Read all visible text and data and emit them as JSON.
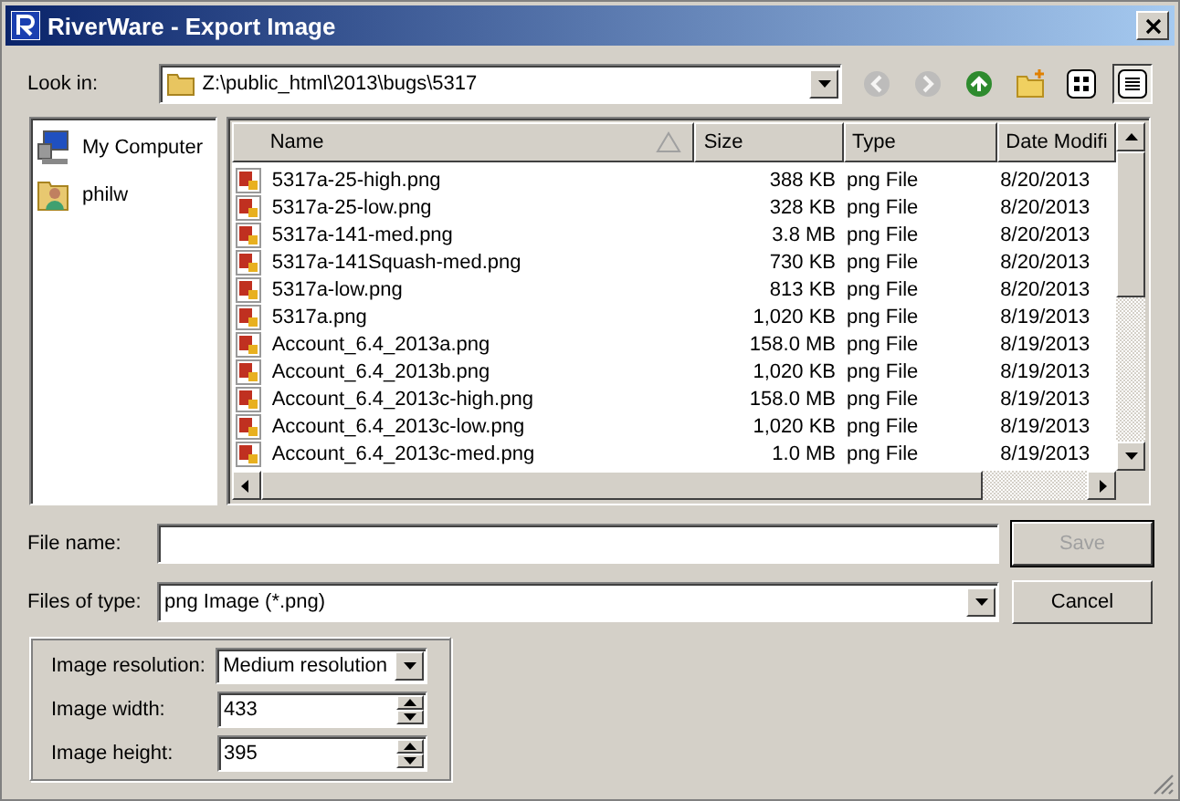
{
  "window": {
    "title": "RiverWare - Export Image"
  },
  "look_in": {
    "label": "Look in:",
    "value": "Z:\\public_html\\2013\\bugs\\5317"
  },
  "toolbar": [
    {
      "kind": "back",
      "disabled": true,
      "selected": false
    },
    {
      "kind": "forward",
      "disabled": true,
      "selected": false
    },
    {
      "kind": "up",
      "disabled": false,
      "selected": false
    },
    {
      "kind": "new-folder",
      "disabled": false,
      "selected": false
    },
    {
      "kind": "list-view",
      "disabled": false,
      "selected": false
    },
    {
      "kind": "details-view",
      "disabled": false,
      "selected": true
    }
  ],
  "places": [
    {
      "kind": "computer",
      "label": "My Computer"
    },
    {
      "kind": "user",
      "label": "philw"
    }
  ],
  "files": {
    "columns": [
      {
        "label": "Name",
        "sorted": true
      },
      {
        "label": "Size",
        "sorted": false
      },
      {
        "label": "Type",
        "sorted": false
      },
      {
        "label": "Date Modifi",
        "sorted": false
      }
    ],
    "rows": [
      {
        "name": "5317a-25-high.png",
        "size": "388 KB",
        "type": "png File",
        "date": "8/20/2013"
      },
      {
        "name": "5317a-25-low.png",
        "size": "328 KB",
        "type": "png File",
        "date": "8/20/2013"
      },
      {
        "name": "5317a-141-med.png",
        "size": "3.8 MB",
        "type": "png File",
        "date": "8/20/2013"
      },
      {
        "name": "5317a-141Squash-med.png",
        "size": "730 KB",
        "type": "png File",
        "date": "8/20/2013"
      },
      {
        "name": "5317a-low.png",
        "size": "813 KB",
        "type": "png File",
        "date": "8/20/2013"
      },
      {
        "name": "5317a.png",
        "size": "1,020 KB",
        "type": "png File",
        "date": "8/19/2013"
      },
      {
        "name": "Account_6.4_2013a.png",
        "size": "158.0 MB",
        "type": "png File",
        "date": "8/19/2013"
      },
      {
        "name": "Account_6.4_2013b.png",
        "size": "1,020 KB",
        "type": "png File",
        "date": "8/19/2013"
      },
      {
        "name": "Account_6.4_2013c-high.png",
        "size": "158.0 MB",
        "type": "png File",
        "date": "8/19/2013"
      },
      {
        "name": "Account_6.4_2013c-low.png",
        "size": "1,020 KB",
        "type": "png File",
        "date": "8/19/2013"
      },
      {
        "name": "Account_6.4_2013c-med.png",
        "size": "1.0 MB",
        "type": "png File",
        "date": "8/19/2013"
      }
    ]
  },
  "file_name": {
    "label": "File name:"
  },
  "file_type": {
    "label": "Files of type:",
    "value": "png Image (*.png)"
  },
  "buttons": [
    {
      "label": "Save",
      "disabled": true
    },
    {
      "label": "Cancel",
      "disabled": false
    }
  ],
  "options": [
    {
      "kind": "dropdown",
      "label": "Image resolution:",
      "value": "Medium resolution"
    },
    {
      "kind": "spinner",
      "label": "Image width:",
      "value": "433"
    },
    {
      "kind": "spinner",
      "label": "Image height:",
      "value": "395"
    }
  ]
}
